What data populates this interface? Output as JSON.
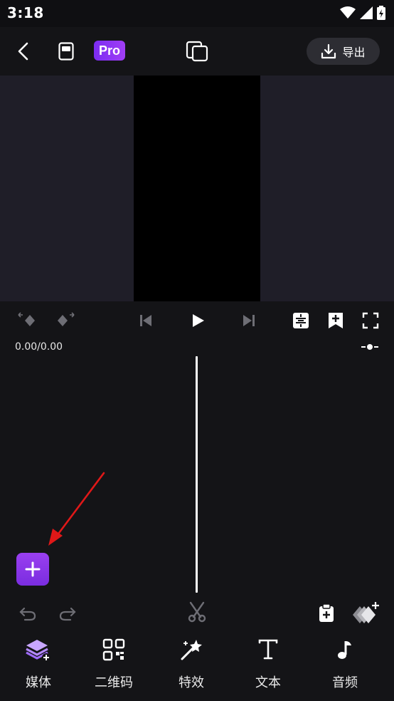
{
  "status_bar": {
    "time": "3:18"
  },
  "top_bar": {
    "pro_label": "Pro",
    "export_label": "导出"
  },
  "player": {
    "time_display": "0.00/0.00"
  },
  "bottom_nav": {
    "items": [
      {
        "label": "媒体",
        "icon": "layers-add-icon"
      },
      {
        "label": "二维码",
        "icon": "qr-code-icon"
      },
      {
        "label": "特效",
        "icon": "magic-wand-icon"
      },
      {
        "label": "文本",
        "icon": "text-icon"
      },
      {
        "label": "音频",
        "icon": "music-note-icon"
      }
    ]
  },
  "colors": {
    "accent": "#8a36ec",
    "background": "#141417",
    "preview_bg": "#1f1e28"
  }
}
